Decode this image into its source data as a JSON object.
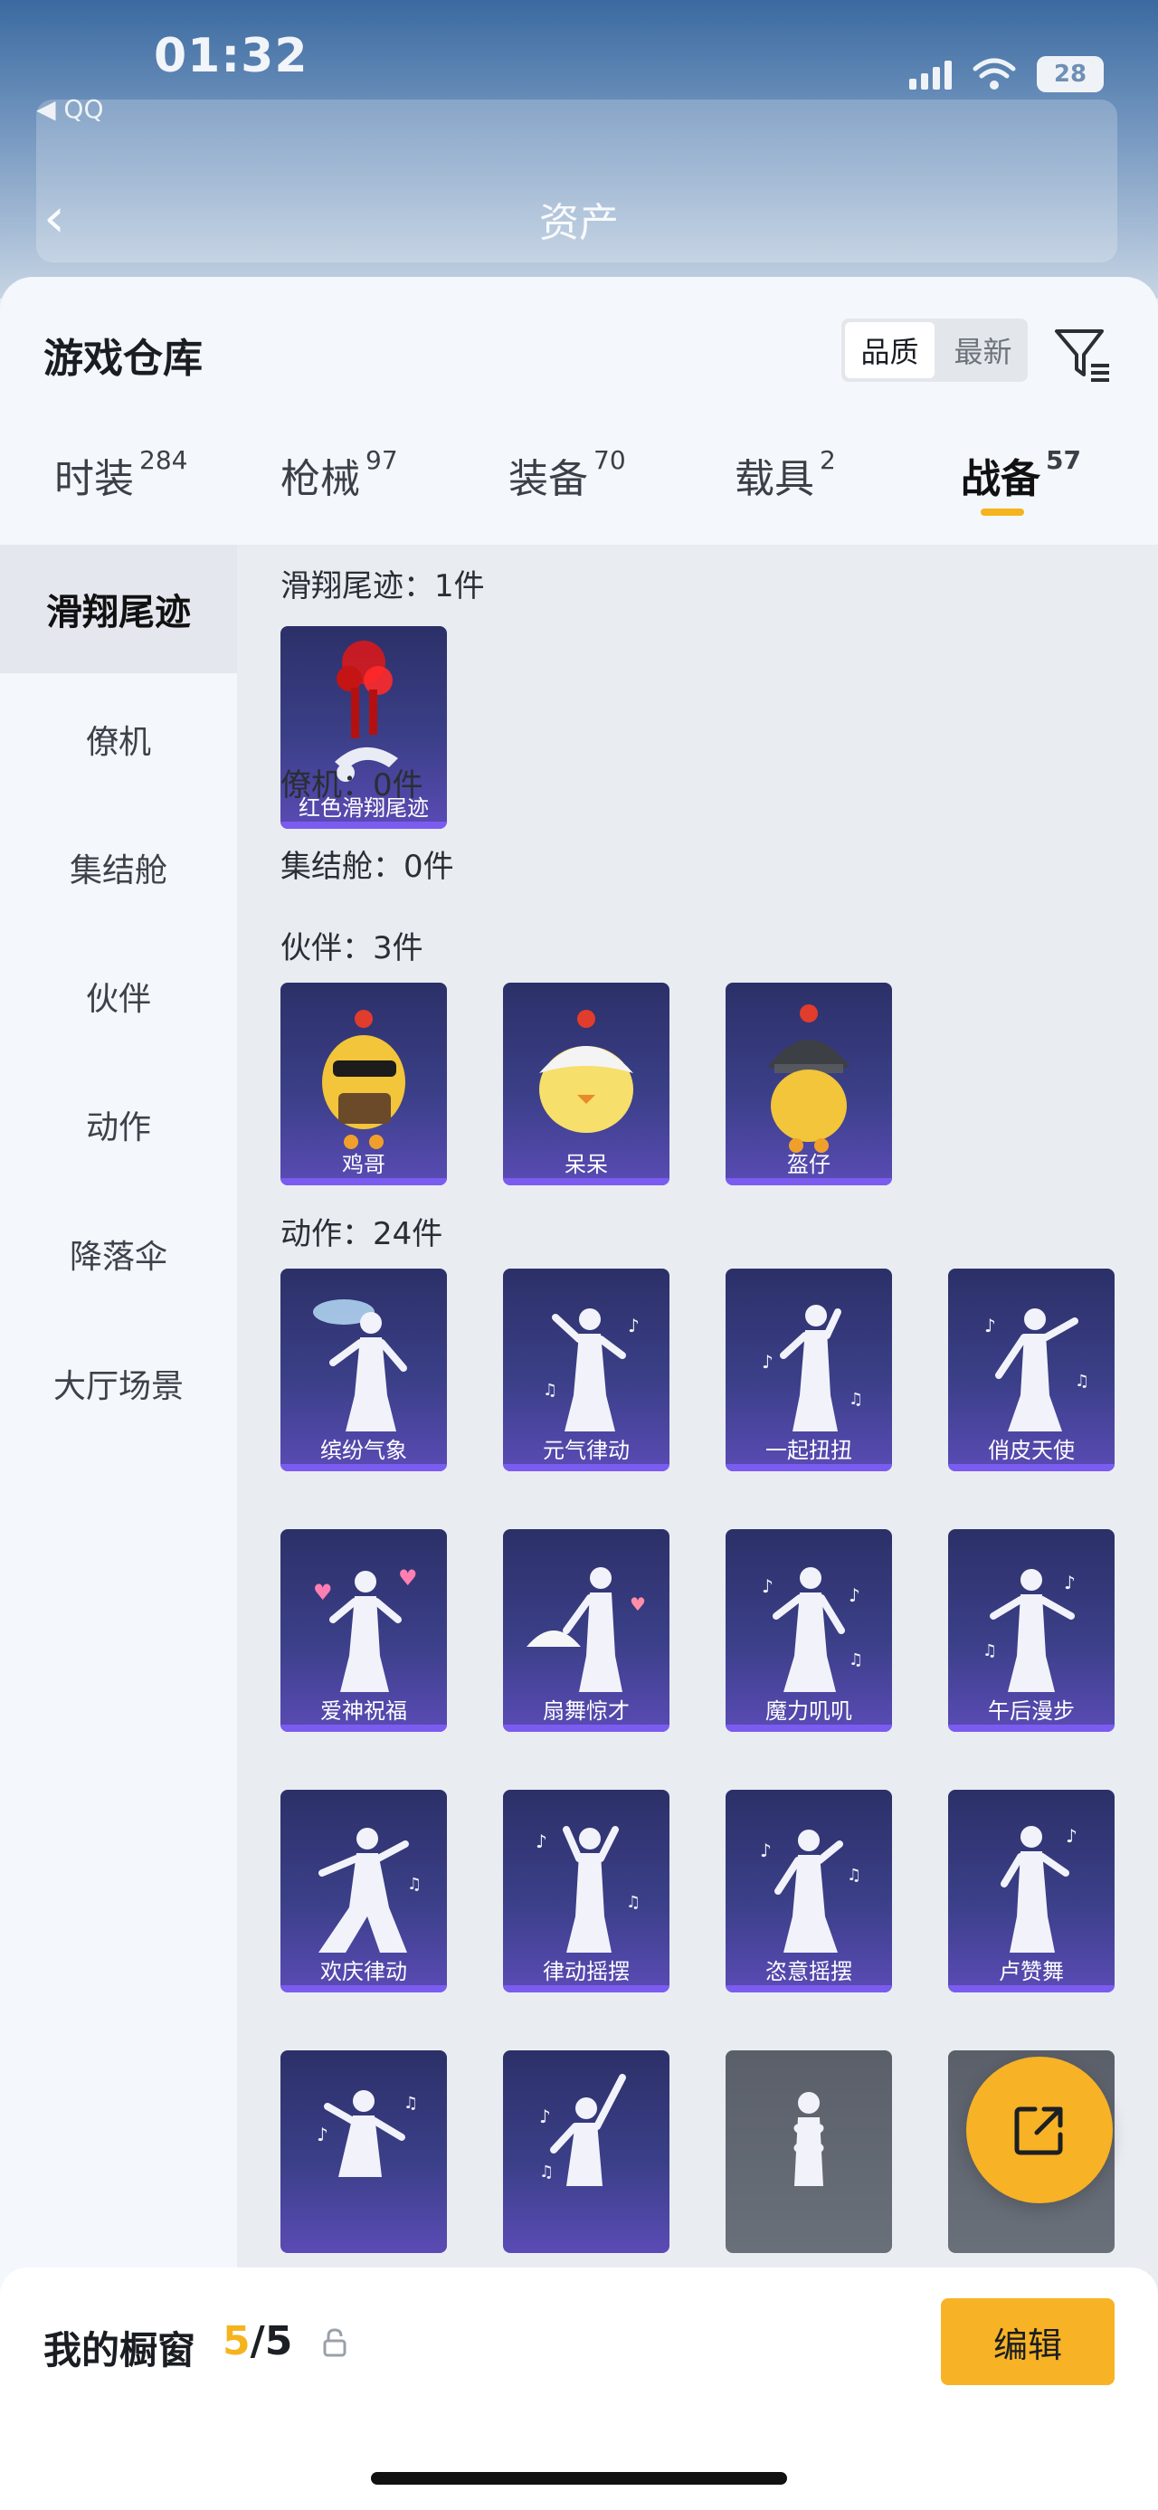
{
  "status_bar": {
    "time": "01:32",
    "back_app": "◀ QQ",
    "battery": "28"
  },
  "nav": {
    "title": "资产"
  },
  "sheet": {
    "title": "游戏仓库",
    "sort": {
      "quality": "品质",
      "newest": "最新"
    }
  },
  "tabs": [
    {
      "label": "时装",
      "count": "284"
    },
    {
      "label": "枪械",
      "count": "97"
    },
    {
      "label": "装备",
      "count": "70"
    },
    {
      "label": "载具",
      "count": "2"
    },
    {
      "label": "战备",
      "count": "57"
    }
  ],
  "sidebar": [
    {
      "label": "滑翔尾迹"
    },
    {
      "label": "僚机"
    },
    {
      "label": "集结舱"
    },
    {
      "label": "伙伴"
    },
    {
      "label": "动作"
    },
    {
      "label": "降落伞"
    },
    {
      "label": "大厅场景"
    }
  ],
  "sections": {
    "trail": {
      "label": "滑翔尾迹：1件",
      "items": [
        "红色滑翔尾迹"
      ]
    },
    "wingman": {
      "label": "僚机：0件"
    },
    "pod": {
      "label": "集结舱：0件"
    },
    "partner": {
      "label": "伙伴：3件",
      "items": [
        "鸡哥",
        "呆呆",
        "盔仔"
      ]
    },
    "emote": {
      "label": "动作：24件",
      "items": [
        "缤纷气象",
        "元气律动",
        "一起扭扭",
        "俏皮天使",
        "爱神祝福",
        "扇舞惊才",
        "魔力叽叽",
        "午后漫步",
        "欢庆律动",
        "律动摇摆",
        "恣意摇摆",
        "卢赞舞"
      ]
    }
  },
  "bottom": {
    "label": "我的橱窗",
    "count_current": "5",
    "count_total": "/5",
    "edit": "编辑"
  },
  "colors": {
    "accent": "#f7b225",
    "card_bg": "#3b3f88",
    "card_bar": "#7b5cf0"
  }
}
